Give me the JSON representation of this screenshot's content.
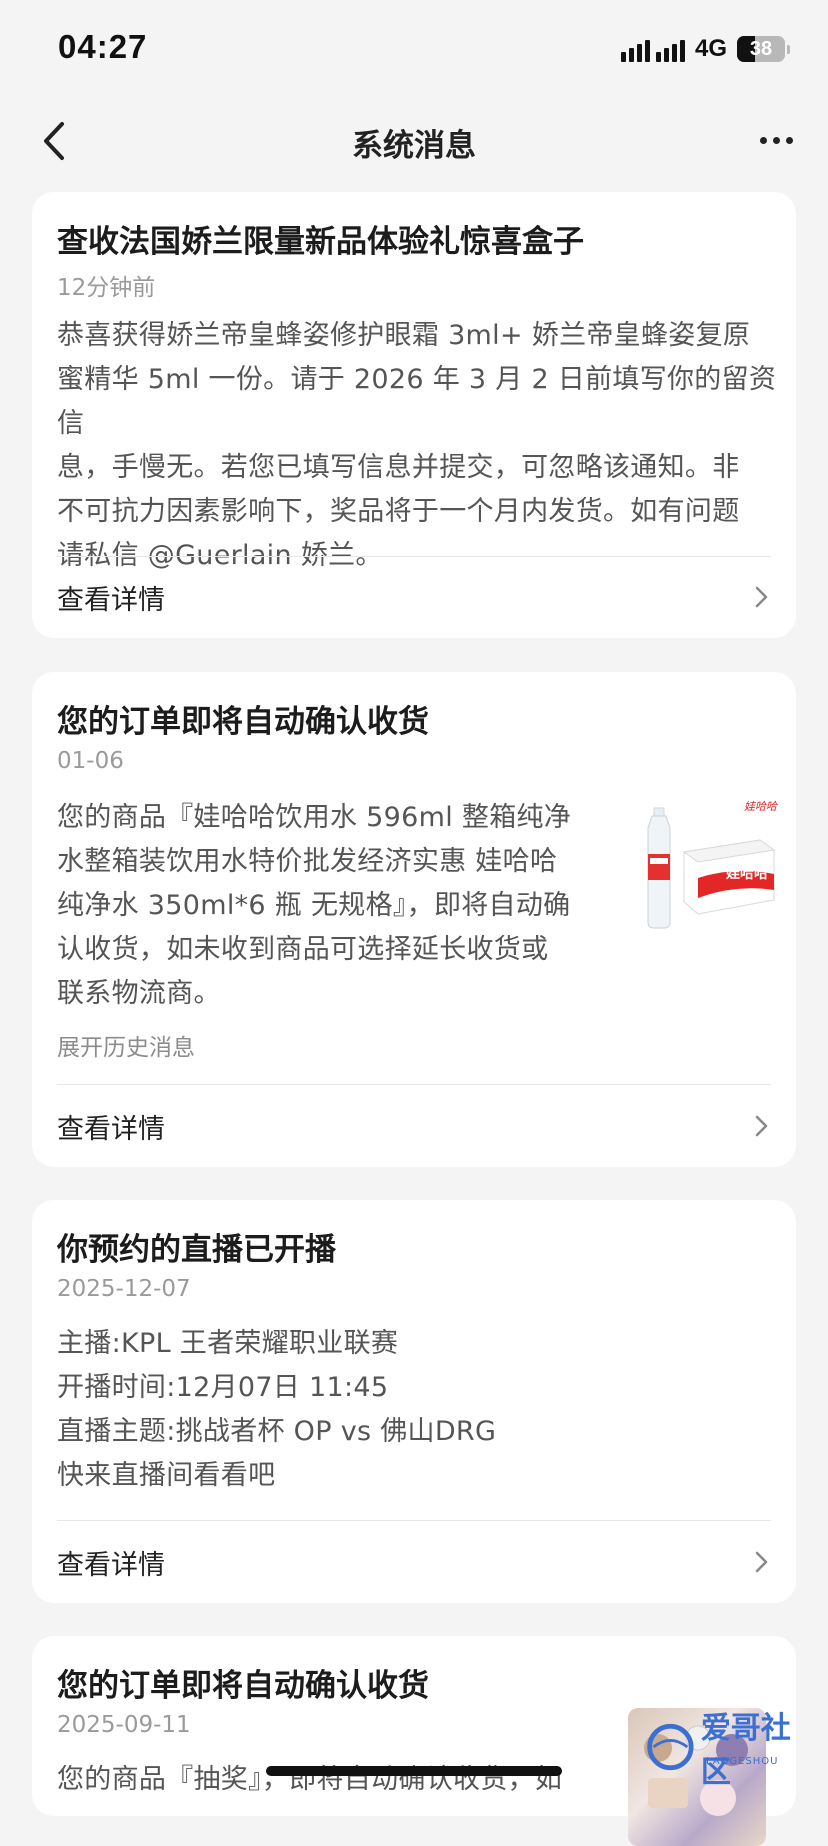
{
  "status_bar": {
    "time": "04:27",
    "network": "4G",
    "battery": "38",
    "battery_level": 0.38
  },
  "nav": {
    "title": "系统消息"
  },
  "messages": [
    {
      "title": "查收法国娇兰限量新品体验礼惊喜盒子",
      "time": "12分钟前",
      "body_lines": [
        "恭喜获得娇兰帝皇蜂姿修护眼霜 3ml+ 娇兰帝皇蜂姿复原",
        "蜜精华 5ml 一份。请于 2026 年 3 月 2 日前填写你的留资信",
        "息，手慢无。若您已填写信息并提交，可忽略该通知。非",
        "不可抗力因素影响下，奖品将于一个月内发货。如有问题",
        "请私信 @Guerlain 娇兰。"
      ],
      "detail_label": "查看详情"
    },
    {
      "title": "您的订单即将自动确认收货",
      "time": "01-06",
      "body_lines": [
        "您的商品『娃哈哈饮用水 596ml 整箱纯净",
        "水整箱装饮用水特价批发经济实惠 娃哈哈",
        "纯净水 350ml*6 瓶 无规格』，即将自动确",
        "认收货，如未收到商品可选择延长收货或",
        "联系物流商。"
      ],
      "expand_label": "展开历史消息",
      "detail_label": "查看详情",
      "thumb_brand": "娃哈哈"
    },
    {
      "title": "你预约的直播已开播",
      "time": "2025-12-07",
      "body_lines": [
        "主播:KPL 王者荣耀职业联赛",
        "开播时间:12月07日 11:45",
        "直播主题:挑战者杯 OP vs 佛山DRG",
        "快来直播间看看吧"
      ],
      "detail_label": "查看详情"
    },
    {
      "title": "您的订单即将自动确认收货",
      "time": "2025-09-11",
      "body_lines": [
        "您的商品『抽奖』，即将自动确认收货，如"
      ]
    }
  ],
  "watermark": {
    "text": "爱哥社区",
    "sub": "LAOGESHOU"
  },
  "colors": {
    "background": "#f4f4f4",
    "card": "#ffffff",
    "brand_red": "#e32626",
    "watermark_blue": "#3b6fd1"
  }
}
